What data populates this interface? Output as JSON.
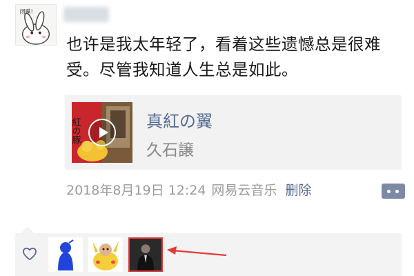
{
  "post": {
    "text": "也许是我太年轻了，看着这些遗憾总是很难受。尽管我知道人生总是如此。"
  },
  "avatar": {
    "caption": "闭嘴！"
  },
  "share_card": {
    "song_title": "真紅の翼",
    "artist": "久石譲",
    "cover_caption": "紅の豚"
  },
  "meta": {
    "timestamp": "2018年8月19日 12:24",
    "source": "网易云音乐",
    "delete_label": "删除"
  },
  "colors": {
    "link": "#576b95",
    "meta_text": "#9b9b9b",
    "card_bg": "#f2f2f2",
    "highlight": "#e03a3a"
  },
  "icons": {
    "like": "heart-icon",
    "more": "more-dots-icon",
    "play": "play-icon"
  }
}
